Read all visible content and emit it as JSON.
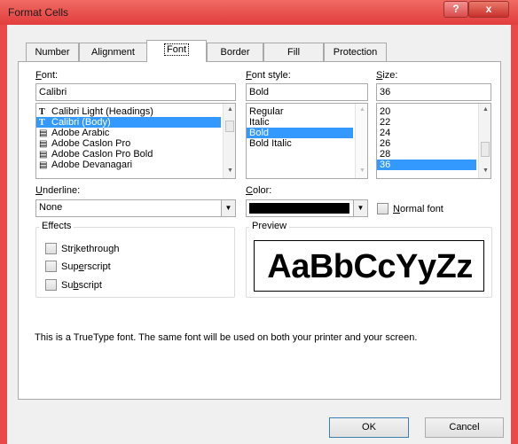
{
  "window": {
    "title": "Format Cells",
    "help": "?",
    "close": "x"
  },
  "tabs": [
    "Number",
    "Alignment",
    "Font",
    "Border",
    "Fill",
    "Protection"
  ],
  "active_tab": "Font",
  "font": {
    "label": "Font:",
    "value": "Calibri",
    "items": [
      {
        "label": "Calibri Light (Headings)",
        "icon": "truetype-icon",
        "selected": false
      },
      {
        "label": "Calibri (Body)",
        "icon": "truetype-icon",
        "selected": true
      },
      {
        "label": "Adobe Arabic",
        "icon": "printer-font-icon",
        "selected": false
      },
      {
        "label": "Adobe Caslon Pro",
        "icon": "printer-font-icon",
        "selected": false
      },
      {
        "label": "Adobe Caslon Pro Bold",
        "icon": "printer-font-icon",
        "selected": false
      },
      {
        "label": "Adobe Devanagari",
        "icon": "printer-font-icon",
        "selected": false
      }
    ]
  },
  "font_style": {
    "label": "Font style:",
    "value": "Bold",
    "items": [
      "Regular",
      "Italic",
      "Bold",
      "Bold Italic"
    ],
    "selected": "Bold"
  },
  "size": {
    "label": "Size:",
    "value": "36",
    "items": [
      "20",
      "22",
      "24",
      "26",
      "28",
      "36"
    ],
    "selected": "36"
  },
  "underline": {
    "label": "Underline:",
    "value": "None"
  },
  "color": {
    "label": "Color:",
    "value": "#000000"
  },
  "normal_font": {
    "label": "Normal font",
    "checked": false
  },
  "effects": {
    "label": "Effects",
    "items": [
      {
        "label": "Strikethrough",
        "checked": false
      },
      {
        "label": "Superscript",
        "checked": false
      },
      {
        "label": "Subscript",
        "checked": false
      }
    ]
  },
  "preview": {
    "label": "Preview",
    "sample": "AaBbCcYyZz"
  },
  "info_text": "This is a TrueType font.  The same font will be used on both your printer and your screen.",
  "buttons": {
    "ok": "OK",
    "cancel": "Cancel"
  },
  "colors": {
    "accent": "#3399ff",
    "titlebar": "#e84a4a"
  }
}
